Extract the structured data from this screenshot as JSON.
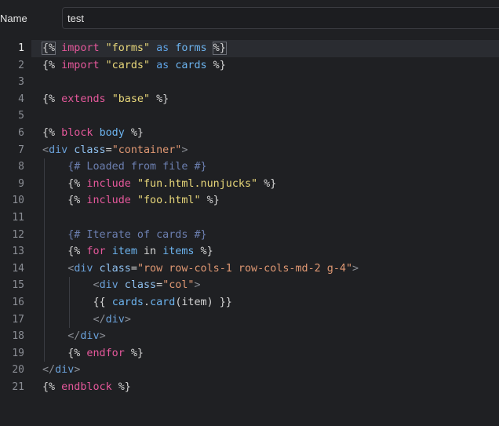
{
  "form": {
    "name_label": "Name",
    "name_value": "test"
  },
  "editor": {
    "line_numbers": [
      "1",
      "2",
      "3",
      "4",
      "5",
      "6",
      "7",
      "8",
      "9",
      "10",
      "11",
      "12",
      "13",
      "14",
      "15",
      "16",
      "17",
      "18",
      "19",
      "20",
      "21"
    ],
    "lines": [
      [
        {
          "t": "{%",
          "c": "p",
          "box": true
        },
        {
          "t": " import ",
          "c": "k"
        },
        {
          "t": "\"forms\"",
          "c": "s"
        },
        {
          "t": " as ",
          "c": "as"
        },
        {
          "t": "forms",
          "c": "id"
        },
        {
          "t": " ",
          "c": "p"
        },
        {
          "t": "%}",
          "c": "p",
          "box": true
        }
      ],
      [
        {
          "t": "{%",
          "c": "p"
        },
        {
          "t": " import ",
          "c": "k"
        },
        {
          "t": "\"cards\"",
          "c": "s"
        },
        {
          "t": " as ",
          "c": "as"
        },
        {
          "t": "cards",
          "c": "id"
        },
        {
          "t": " %}",
          "c": "p"
        }
      ],
      [],
      [
        {
          "t": "{%",
          "c": "p"
        },
        {
          "t": " extends ",
          "c": "k"
        },
        {
          "t": "\"base\"",
          "c": "s"
        },
        {
          "t": " %}",
          "c": "p"
        }
      ],
      [],
      [
        {
          "t": "{%",
          "c": "p"
        },
        {
          "t": " block ",
          "c": "k"
        },
        {
          "t": "body",
          "c": "id"
        },
        {
          "t": " %}",
          "c": "p"
        }
      ],
      [
        {
          "t": "<",
          "c": "ang"
        },
        {
          "t": "div",
          "c": "tag"
        },
        {
          "t": " class",
          "c": "attr"
        },
        {
          "t": "=",
          "c": "p"
        },
        {
          "t": "\"container\"",
          "c": "str2"
        },
        {
          "t": ">",
          "c": "ang"
        }
      ],
      [
        {
          "t": "    ",
          "c": "p"
        },
        {
          "t": "{# Loaded from file #}",
          "c": "c"
        }
      ],
      [
        {
          "t": "    ",
          "c": "p"
        },
        {
          "t": "{%",
          "c": "p"
        },
        {
          "t": " include ",
          "c": "k"
        },
        {
          "t": "\"fun.html.nunjucks\"",
          "c": "s"
        },
        {
          "t": " %}",
          "c": "p"
        }
      ],
      [
        {
          "t": "    ",
          "c": "p"
        },
        {
          "t": "{%",
          "c": "p"
        },
        {
          "t": " include ",
          "c": "k"
        },
        {
          "t": "\"foo.html\"",
          "c": "s"
        },
        {
          "t": " %}",
          "c": "p"
        }
      ],
      [],
      [
        {
          "t": "    ",
          "c": "p"
        },
        {
          "t": "{# Iterate of cards #}",
          "c": "c"
        }
      ],
      [
        {
          "t": "    ",
          "c": "p"
        },
        {
          "t": "{%",
          "c": "p"
        },
        {
          "t": " for ",
          "c": "k"
        },
        {
          "t": "item",
          "c": "id"
        },
        {
          "t": " in ",
          "c": "p"
        },
        {
          "t": "items",
          "c": "id"
        },
        {
          "t": " %}",
          "c": "p"
        }
      ],
      [
        {
          "t": "    ",
          "c": "p"
        },
        {
          "t": "<",
          "c": "ang"
        },
        {
          "t": "div",
          "c": "tag"
        },
        {
          "t": " class",
          "c": "attr"
        },
        {
          "t": "=",
          "c": "p"
        },
        {
          "t": "\"row row-cols-1 row-cols-md-2 g-4\"",
          "c": "str2"
        },
        {
          "t": ">",
          "c": "ang"
        }
      ],
      [
        {
          "t": "        ",
          "c": "p"
        },
        {
          "t": "<",
          "c": "ang"
        },
        {
          "t": "div",
          "c": "tag"
        },
        {
          "t": " class",
          "c": "attr"
        },
        {
          "t": "=",
          "c": "p"
        },
        {
          "t": "\"col\"",
          "c": "str2"
        },
        {
          "t": ">",
          "c": "ang"
        }
      ],
      [
        {
          "t": "        ",
          "c": "p"
        },
        {
          "t": "{{ ",
          "c": "p"
        },
        {
          "t": "cards",
          "c": "id"
        },
        {
          "t": ".",
          "c": "p"
        },
        {
          "t": "card",
          "c": "id"
        },
        {
          "t": "(item) }}",
          "c": "p"
        }
      ],
      [
        {
          "t": "        ",
          "c": "p"
        },
        {
          "t": "</",
          "c": "ang"
        },
        {
          "t": "div",
          "c": "tag"
        },
        {
          "t": ">",
          "c": "ang"
        }
      ],
      [
        {
          "t": "    ",
          "c": "p"
        },
        {
          "t": "</",
          "c": "ang"
        },
        {
          "t": "div",
          "c": "tag"
        },
        {
          "t": ">",
          "c": "ang"
        }
      ],
      [
        {
          "t": "    ",
          "c": "p"
        },
        {
          "t": "{%",
          "c": "p"
        },
        {
          "t": " endfor ",
          "c": "k"
        },
        {
          "t": "%}",
          "c": "p"
        }
      ],
      [
        {
          "t": "</",
          "c": "ang"
        },
        {
          "t": "div",
          "c": "tag"
        },
        {
          "t": ">",
          "c": "ang"
        }
      ],
      [
        {
          "t": "{%",
          "c": "p"
        },
        {
          "t": " endblock ",
          "c": "k"
        },
        {
          "t": "%}",
          "c": "p"
        }
      ]
    ],
    "indent_levels": [
      0,
      0,
      0,
      0,
      0,
      0,
      0,
      1,
      1,
      1,
      1,
      1,
      1,
      1,
      2,
      2,
      2,
      1,
      1,
      0,
      0
    ]
  }
}
